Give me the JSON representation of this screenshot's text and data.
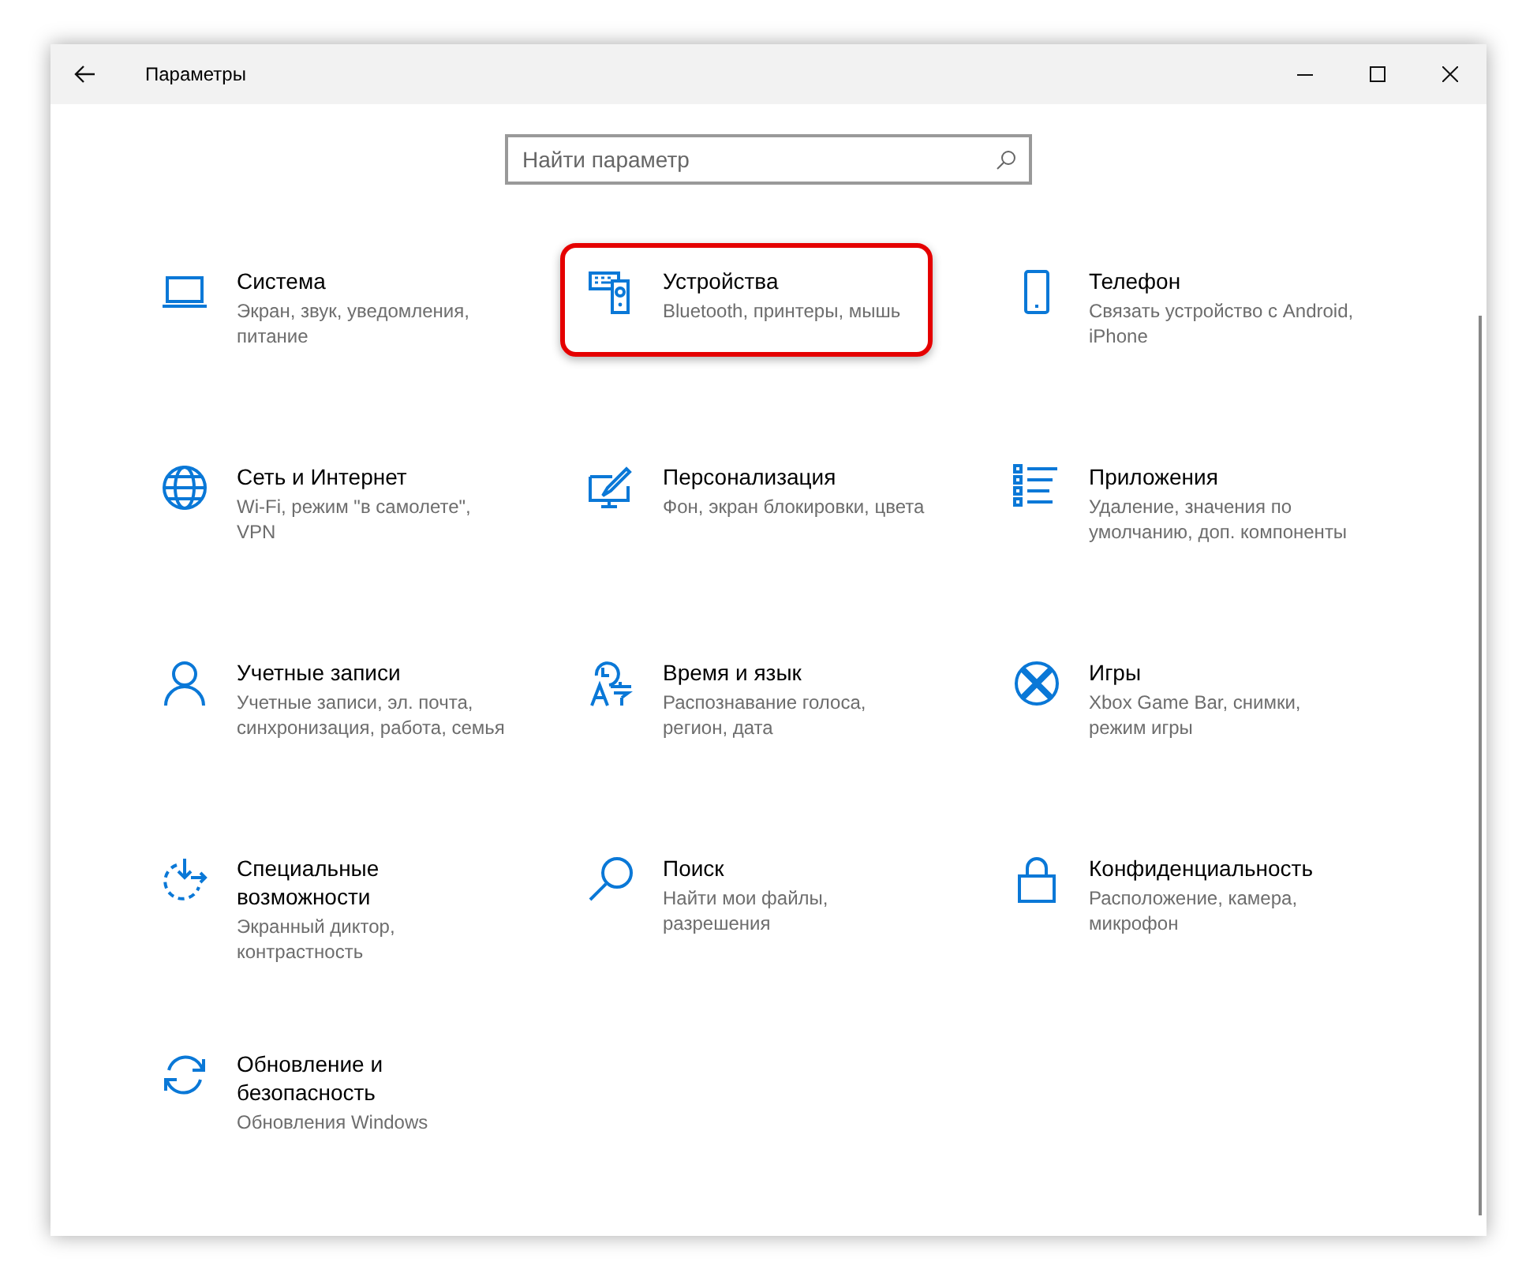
{
  "window": {
    "title": "Параметры"
  },
  "search": {
    "placeholder": "Найти параметр"
  },
  "items": [
    {
      "title_lines": [
        "Система"
      ],
      "description_lines": [
        "Экран, звук, уведомления,",
        "питание"
      ],
      "highlighted": false
    },
    {
      "title_lines": [
        "Устройства"
      ],
      "description_lines": [
        "Bluetooth, принтеры, мышь"
      ],
      "highlighted": true
    },
    {
      "title_lines": [
        "Телефон"
      ],
      "description_lines": [
        "Связать устройство с Android,",
        "iPhone"
      ],
      "highlighted": false
    },
    {
      "title_lines": [
        "Сеть и Интернет"
      ],
      "description_lines": [
        "Wi-Fi, режим \"в самолете\",",
        "VPN"
      ],
      "highlighted": false
    },
    {
      "title_lines": [
        "Персонализация"
      ],
      "description_lines": [
        "Фон, экран блокировки, цвета"
      ],
      "highlighted": false
    },
    {
      "title_lines": [
        "Приложения"
      ],
      "description_lines": [
        "Удаление, значения по",
        "умолчанию, доп. компоненты"
      ],
      "highlighted": false
    },
    {
      "title_lines": [
        "Учетные записи"
      ],
      "description_lines": [
        "Учетные записи, эл. почта,",
        "синхронизация, работа, семья"
      ],
      "highlighted": false
    },
    {
      "title_lines": [
        "Время и язык"
      ],
      "description_lines": [
        "Распознавание голоса,",
        "регион, дата"
      ],
      "highlighted": false
    },
    {
      "title_lines": [
        "Игры"
      ],
      "description_lines": [
        "Xbox Game Bar, снимки,",
        "режим игры"
      ],
      "highlighted": false
    },
    {
      "title_lines": [
        "Специальные",
        "возможности"
      ],
      "description_lines": [
        "Экранный диктор,",
        "контрастность"
      ],
      "highlighted": false
    },
    {
      "title_lines": [
        "Поиск"
      ],
      "description_lines": [
        "Найти мои файлы,",
        "разрешения"
      ],
      "highlighted": false
    },
    {
      "title_lines": [
        "Конфиденциальность"
      ],
      "description_lines": [
        "Расположение, камера,",
        "микрофон"
      ],
      "highlighted": false
    },
    {
      "title_lines": [
        "Обновление и",
        "безопасность"
      ],
      "description_lines": [
        "Обновления Windows"
      ],
      "highlighted": false
    }
  ]
}
